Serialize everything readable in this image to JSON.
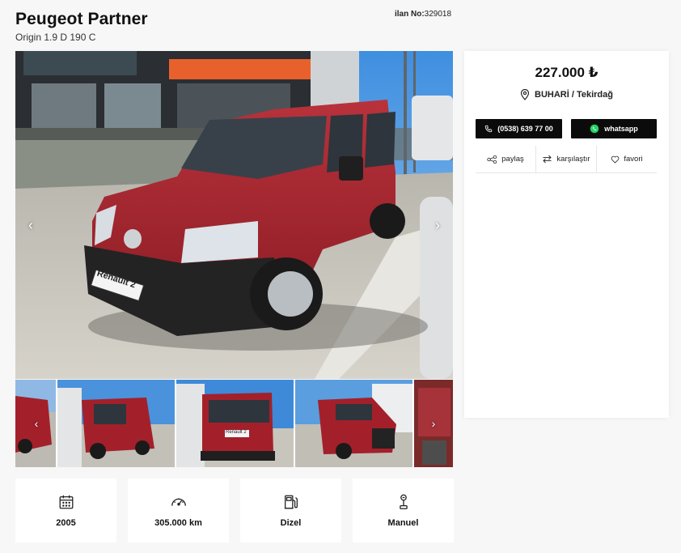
{
  "listing": {
    "title": "Peugeot Partner",
    "subtitle": "Origin 1.9 D 190 C",
    "number_label": "ilan No:",
    "number_value": "329018"
  },
  "gallery": {
    "plate_main": "Renault 2",
    "plate_thumb": "Renault 2",
    "thumbnail_count": 5
  },
  "specs": [
    {
      "icon": "calendar-icon",
      "value": "2005"
    },
    {
      "icon": "speedometer-icon",
      "value": "305.000 km"
    },
    {
      "icon": "fuel-pump-icon",
      "value": "Dizel"
    },
    {
      "icon": "gear-shift-icon",
      "value": "Manuel"
    }
  ],
  "panel": {
    "price": "227.000 ₺",
    "location": "BUHARİ / Tekirdağ",
    "phone_label": "(0538) 639 77 00",
    "whatsapp_label": "whatsapp",
    "actions": {
      "share": "paylaş",
      "compare": "karşılaştır",
      "favorite": "favori"
    }
  },
  "colors": {
    "car_red": "#a3202a",
    "button_black": "#0b0b0b",
    "whatsapp_green": "#25d366"
  }
}
